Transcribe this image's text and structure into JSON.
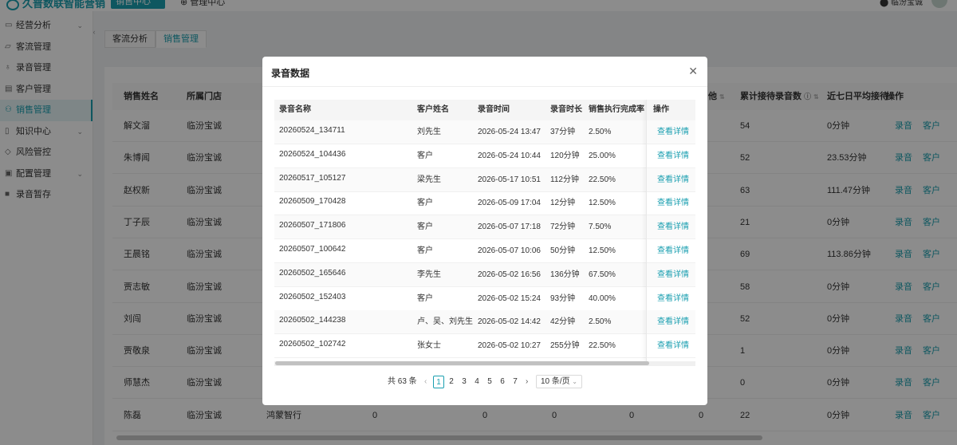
{
  "app": {
    "title": "久普数联智能营销",
    "nav": {
      "active": "销售中心",
      "other": "管理中心"
    },
    "location": "临汾宝诚"
  },
  "sidebar": {
    "items": [
      {
        "label": "经营分析",
        "icon": "chart-icon",
        "arrow": true
      },
      {
        "label": "客流管理",
        "icon": "folder-icon",
        "arrow": false
      },
      {
        "label": "录音管理",
        "icon": "mic-icon",
        "arrow": false
      },
      {
        "label": "客户管理",
        "icon": "user-card-icon",
        "arrow": false
      },
      {
        "label": "销售管理",
        "icon": "users-icon",
        "arrow": false,
        "active": true
      },
      {
        "label": "知识中心",
        "icon": "book-icon",
        "arrow": true
      },
      {
        "label": "风险管控",
        "icon": "shield-icon",
        "arrow": false
      },
      {
        "label": "配置管理",
        "icon": "settings-icon",
        "arrow": true
      },
      {
        "label": "录音暂存",
        "icon": "trash-icon",
        "arrow": false
      }
    ]
  },
  "tabs": [
    {
      "label": "客流分析",
      "active": false
    },
    {
      "label": "销售管理",
      "active": true
    }
  ],
  "bg_table": {
    "headers": {
      "name": "销售姓名",
      "store": "所属门店",
      "other": "他",
      "total": "累计接待录音数",
      "avg7": "近七日平均接待",
      "op": "操作"
    },
    "ops": {
      "record": "录音",
      "customer": "客户"
    },
    "rows": [
      {
        "name": "解文溜",
        "store": "临汾宝诚",
        "total": "54",
        "avg7": "0分钟"
      },
      {
        "name": "朱博闻",
        "store": "临汾宝诚",
        "total": "52",
        "avg7": "23.53分钟"
      },
      {
        "name": "赵权新",
        "store": "临汾宝诚",
        "total": "63",
        "avg7": "111.47分钟"
      },
      {
        "name": "丁子辰",
        "store": "临汾宝诚",
        "total": "21",
        "avg7": "0分钟"
      },
      {
        "name": "王晨铭",
        "store": "临汾宝诚",
        "total": "69",
        "avg7": "113.86分钟"
      },
      {
        "name": "贾志敏",
        "store": "临汾宝诚",
        "total": "58",
        "avg7": "0分钟"
      },
      {
        "name": "刘闯",
        "store": "临汾宝诚",
        "total": "52",
        "avg7": "0分钟"
      },
      {
        "name": "贾敬泉",
        "store": "临汾宝诚",
        "total": "1",
        "avg7": "0分钟"
      },
      {
        "name": "师慧杰",
        "store": "临汾宝诚",
        "total": "0",
        "avg7": "0分钟"
      },
      {
        "name": "陈磊",
        "store": "临汾宝诚",
        "total": "22",
        "avg7": "0分钟",
        "group": "鸿蒙智行",
        "zeros": [
          "0",
          "0",
          "0",
          "0",
          "0"
        ]
      }
    ]
  },
  "modal": {
    "title": "录音数据",
    "headers": {
      "name": "录音名称",
      "customer": "客户姓名",
      "time": "录音时间",
      "duration": "录音时长",
      "rate": "销售执行完成率",
      "op": "操作"
    },
    "detail_label": "查看详情",
    "rows": [
      {
        "name": "20260524_134711",
        "customer": "刘先生",
        "time": "2026-05-24 13:47",
        "duration": "37分钟",
        "rate": "2.50%"
      },
      {
        "name": "20260524_104436",
        "customer": "客户",
        "time": "2026-05-24 10:44",
        "duration": "120分钟",
        "rate": "25.00%"
      },
      {
        "name": "20260517_105127",
        "customer": "梁先生",
        "time": "2026-05-17 10:51",
        "duration": "112分钟",
        "rate": "22.50%"
      },
      {
        "name": "20260509_170428",
        "customer": "客户",
        "time": "2026-05-09 17:04",
        "duration": "12分钟",
        "rate": "12.50%"
      },
      {
        "name": "20260507_171806",
        "customer": "客户",
        "time": "2026-05-07 17:18",
        "duration": "72分钟",
        "rate": "7.50%"
      },
      {
        "name": "20260507_100642",
        "customer": "客户",
        "time": "2026-05-07 10:06",
        "duration": "50分钟",
        "rate": "12.50%"
      },
      {
        "name": "20260502_165646",
        "customer": "李先生",
        "time": "2026-05-02 16:56",
        "duration": "136分钟",
        "rate": "67.50%"
      },
      {
        "name": "20260502_152403",
        "customer": "客户",
        "time": "2026-05-02 15:24",
        "duration": "93分钟",
        "rate": "40.00%"
      },
      {
        "name": "20260502_144238",
        "customer": "卢、吴、刘先生",
        "time": "2026-05-02 14:42",
        "duration": "42分钟",
        "rate": "2.50%"
      },
      {
        "name": "20260502_102742",
        "customer": "张女士",
        "time": "2026-05-02 10:27",
        "duration": "255分钟",
        "rate": "22.50%"
      }
    ],
    "pager": {
      "total": "共 63 条",
      "pages": [
        "1",
        "2",
        "3",
        "4",
        "5",
        "6",
        "7"
      ],
      "current": "1",
      "page_size": "10 条/页"
    }
  },
  "colors": {
    "accent": "#1a9fb0"
  }
}
